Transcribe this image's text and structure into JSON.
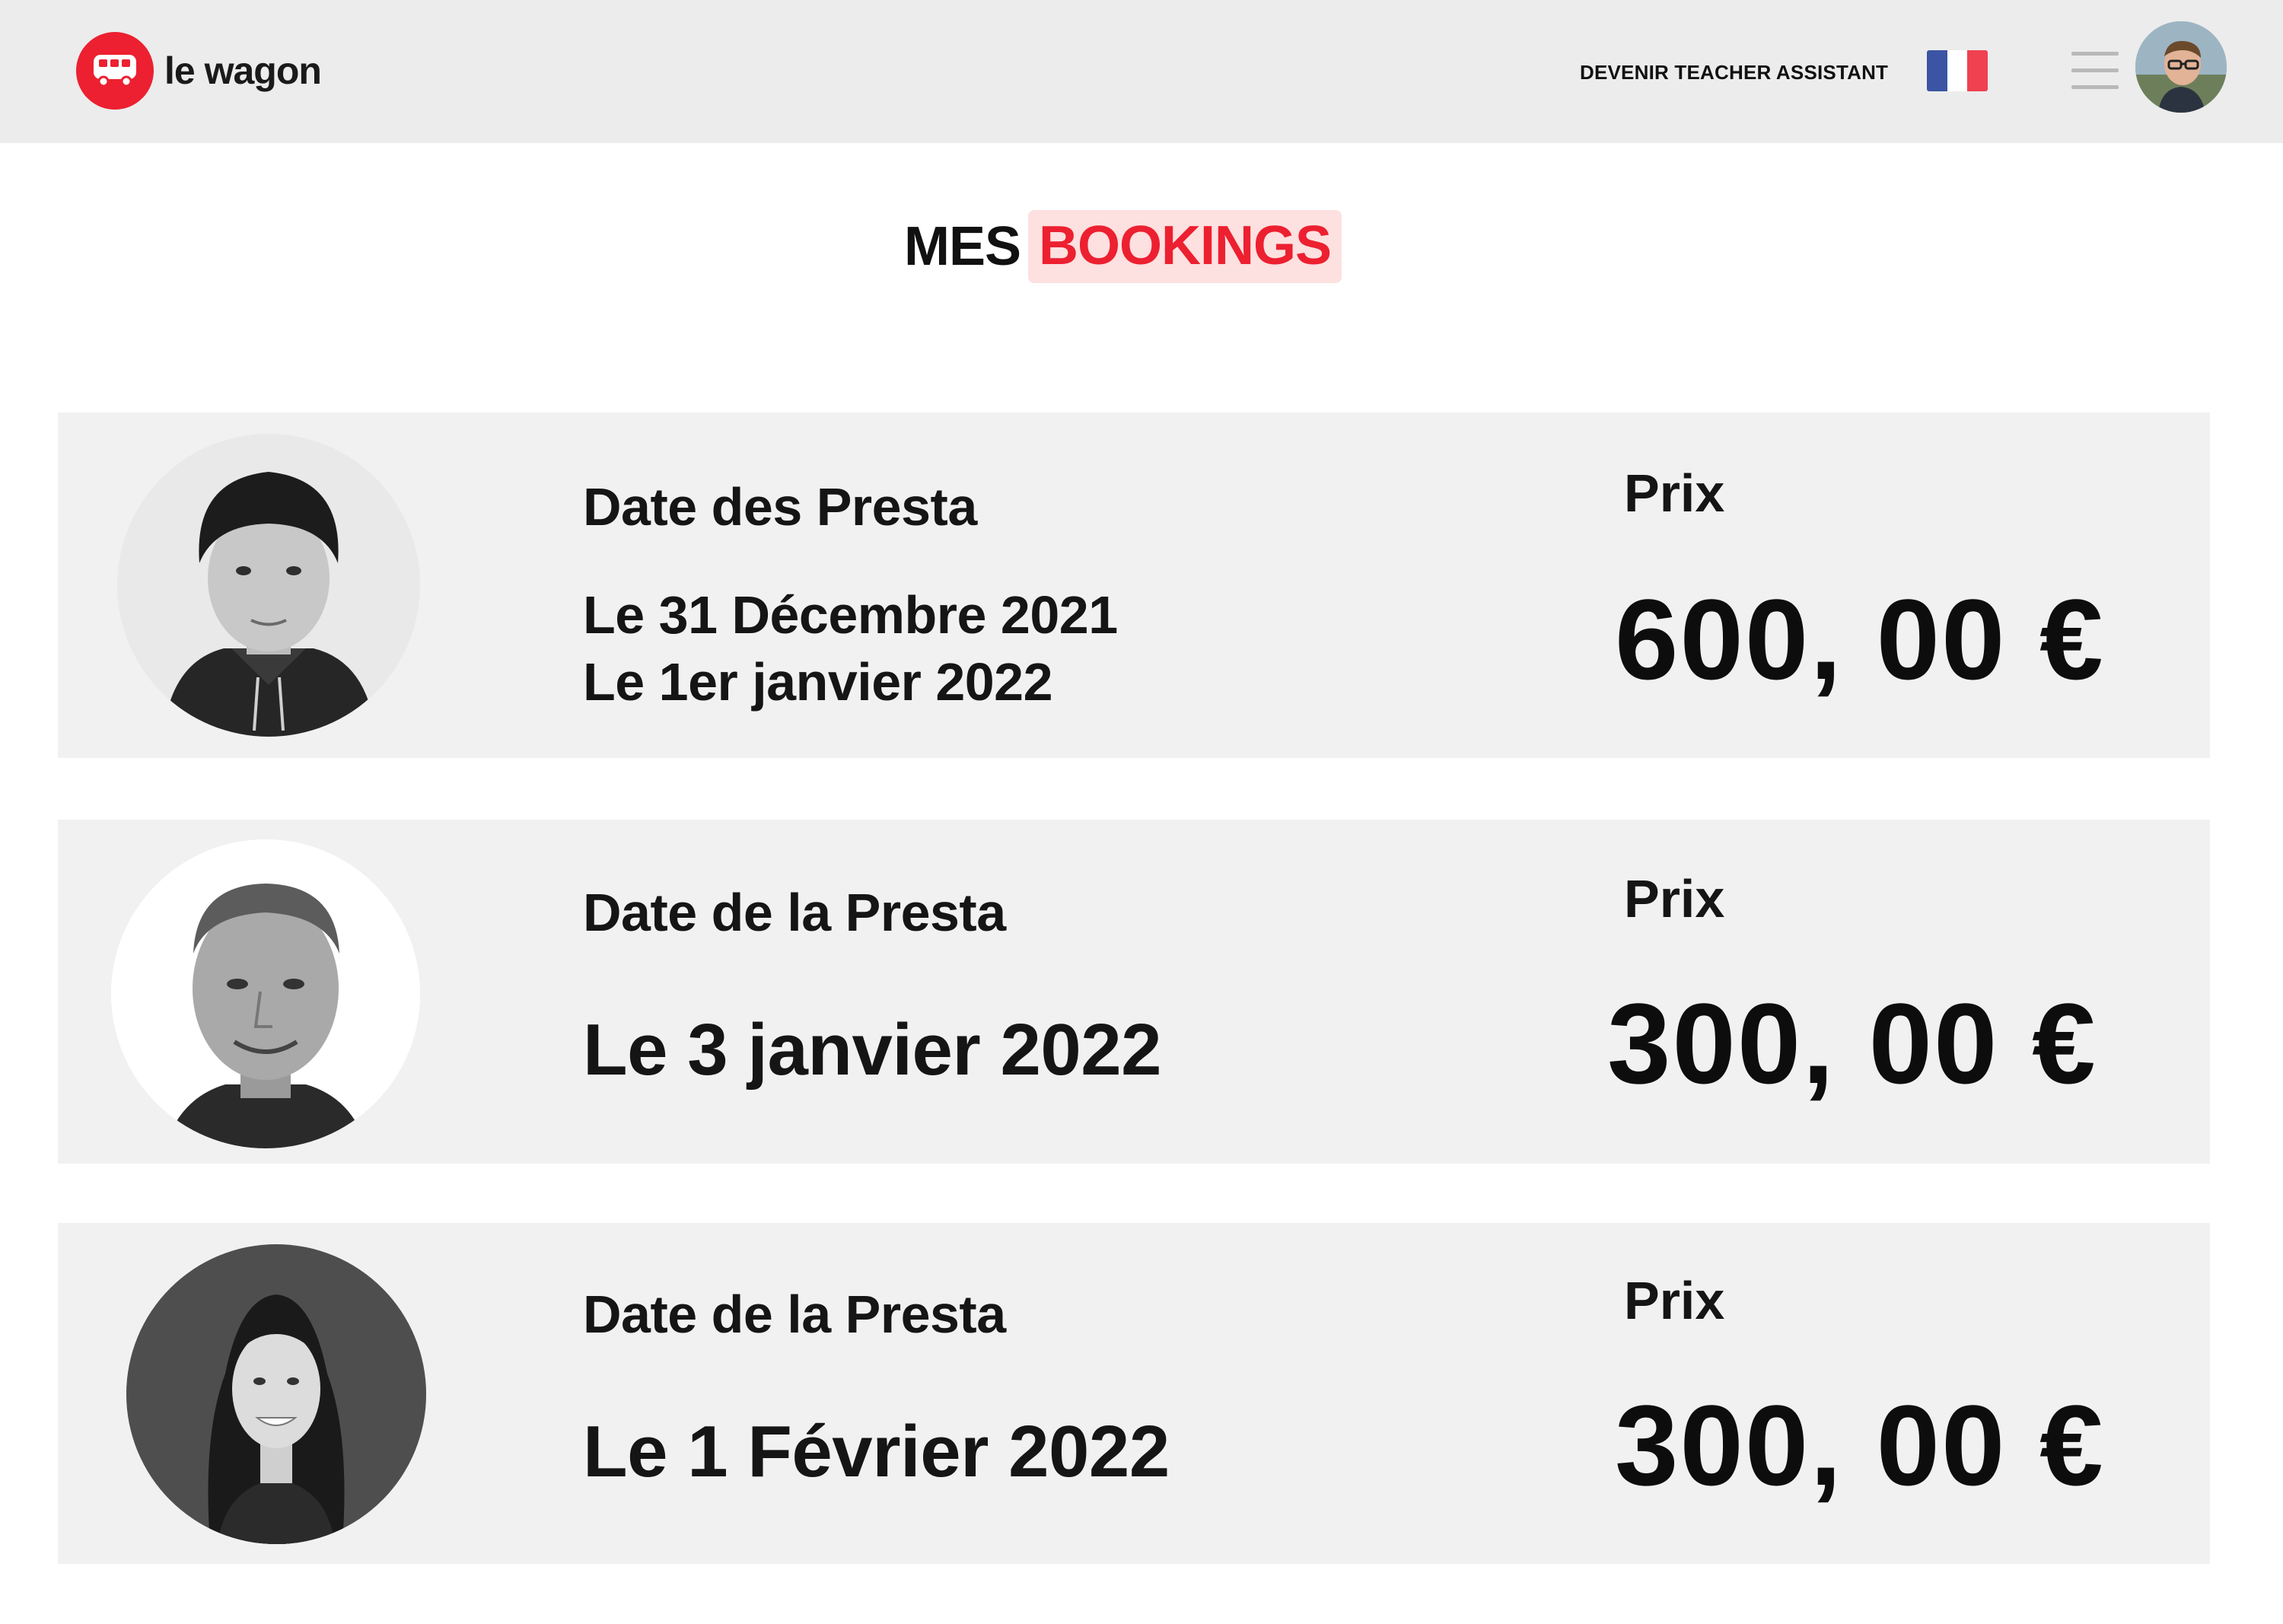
{
  "navbar": {
    "logo_text": "le wagon",
    "cta_link": "DEVENIR TEACHER ASSISTANT",
    "flag_colors": [
      "#3b55a4",
      "#ffffff",
      "#ef4150"
    ]
  },
  "page": {
    "title_prefix": "MES",
    "title_highlight": "BOOKINGS",
    "accent_color": "#ec2030"
  },
  "bookings": [
    {
      "date_label": "Date des Presta",
      "dates": [
        "Le 31 Décembre 2021",
        "Le 1er janvier 2022"
      ],
      "price_label": "Prix",
      "price": "600, 00 €"
    },
    {
      "date_label": "Date de la Presta",
      "dates": [
        "Le 3 janvier 2022"
      ],
      "price_label": "Prix",
      "price": "300, 00 €"
    },
    {
      "date_label": "Date de la Presta",
      "dates": [
        "Le 1 Février 2022"
      ],
      "price_label": "Prix",
      "price": "300, 00 €"
    }
  ]
}
